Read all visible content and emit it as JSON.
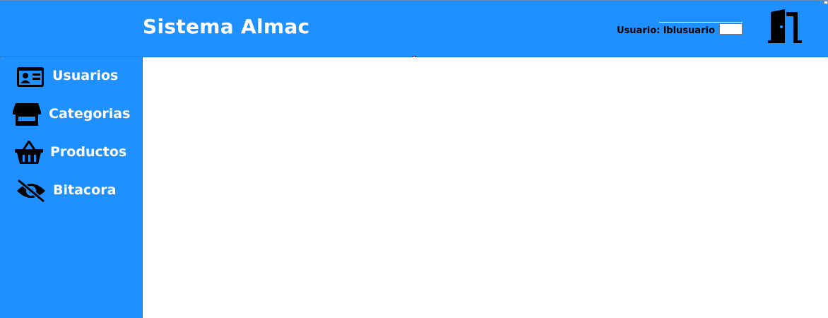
{
  "header": {
    "title": "Sistema Almac",
    "user_label": "Usuario: lblusuario",
    "exit_icon": "door-exit-icon"
  },
  "sidebar": {
    "items": [
      {
        "label": "Usuarios",
        "icon": "id-card-icon"
      },
      {
        "label": "Categorias",
        "icon": "store-icon"
      },
      {
        "label": "Productos",
        "icon": "basket-icon"
      },
      {
        "label": "Bitacora",
        "icon": "eye-slash-icon"
      }
    ]
  },
  "colors": {
    "primary": "#1e90ff",
    "text_light": "#ffffff",
    "text_dark": "#000000"
  }
}
